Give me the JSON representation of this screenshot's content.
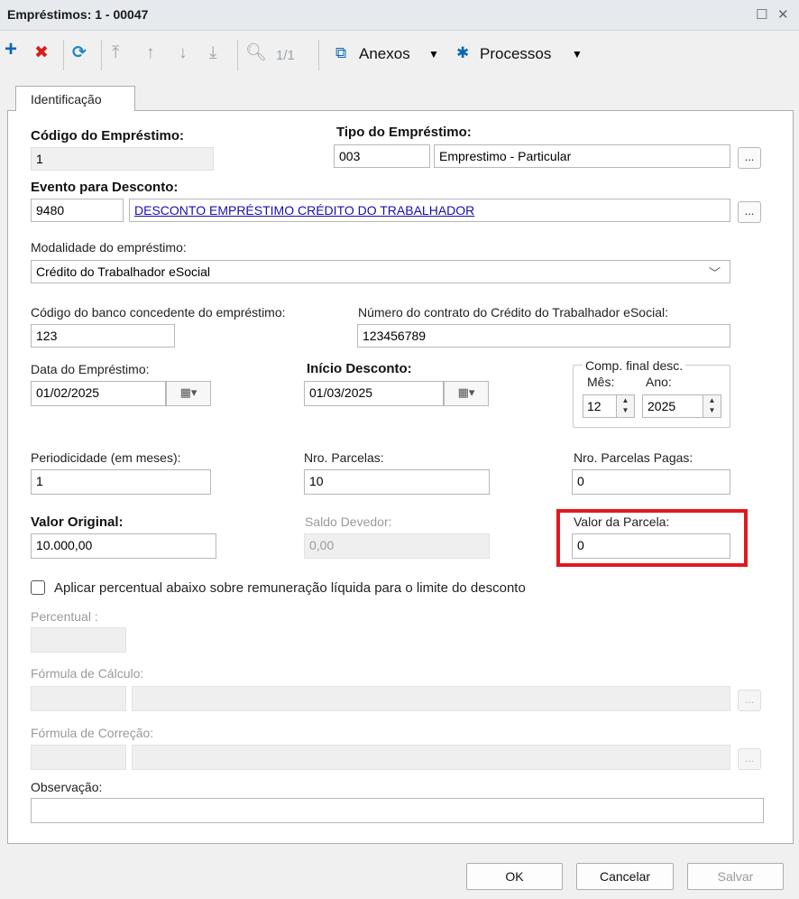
{
  "window": {
    "title": "Empréstimos: 1 - 00047"
  },
  "toolbar": {
    "page_indicator": "1/1",
    "anexos_label": "Anexos",
    "processos_label": "Processos",
    "colors": {
      "add": "#0a66b7",
      "delete": "#d91c1c",
      "refresh": "#1a87c9",
      "disabled": "#9aa3ad"
    }
  },
  "tabs": [
    {
      "label": "Identificação"
    }
  ],
  "form": {
    "codigo_label": "Código do Empréstimo:",
    "codigo_value": "1",
    "tipo_label": "Tipo do Empréstimo:",
    "tipo_code": "003",
    "tipo_desc": "Emprestimo - Particular",
    "evento_label": "Evento para Desconto:",
    "evento_code": "9480",
    "evento_desc": "DESCONTO EMPRÉSTIMO CRÉDITO DO TRABALHADOR",
    "modalidade_label": "Modalidade do empréstimo:",
    "modalidade_value": "Crédito do Trabalhador eSocial",
    "banco_label": "Código do banco concedente do empréstimo:",
    "banco_value": "123",
    "contrato_label": "Número do contrato do Crédito do Trabalhador eSocial:",
    "contrato_value": "123456789",
    "data_label": "Data do Empréstimo:",
    "data_value": "01/02/2025",
    "inicio_label": "Início Desconto:",
    "inicio_value": "01/03/2025",
    "comp_title": "Comp. final desc.",
    "mes_label": "Mês:",
    "mes_value": "12",
    "ano_label": "Ano:",
    "ano_value": "2025",
    "periodicidade_label": "Periodicidade (em meses):",
    "periodicidade_value": "1",
    "parcelas_label": "Nro. Parcelas:",
    "parcelas_value": "10",
    "pagas_label": "Nro. Parcelas Pagas:",
    "pagas_value": "0",
    "valor_original_label": "Valor Original:",
    "valor_original_value": "10.000,00",
    "saldo_label": "Saldo Devedor:",
    "saldo_value": "0,00",
    "valor_parcela_label": "Valor da Parcela:",
    "valor_parcela_value": "0",
    "checkbox_label": "Aplicar percentual abaixo sobre remuneração líquida para o limite do desconto",
    "percentual_label": "Percentual :",
    "formula_calculo_label": "Fórmula de Cálculo:",
    "formula_correcao_label": "Fórmula de Correção:",
    "observacao_label": "Observação:",
    "dots": "..."
  },
  "footer": {
    "ok": "OK",
    "cancel": "Cancelar",
    "save": "Salvar"
  },
  "highlight_color": "#e0191f"
}
